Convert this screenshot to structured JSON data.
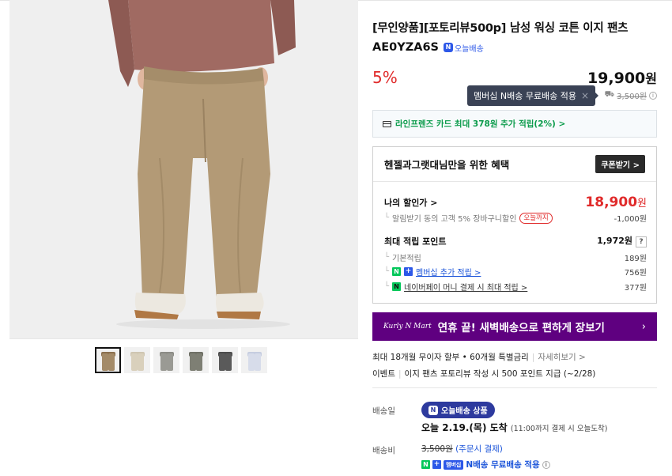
{
  "product": {
    "title": "[무인양품][포토리뷰500p] 남성 워싱 코튼 이지 팬츠",
    "code": "AE0YZA6S",
    "today_delivery_badge": "오늘배송",
    "discount_rate": "5%",
    "price": "19,900",
    "price_unit": "원"
  },
  "tooltip": {
    "text": "멤버십 N배송 무료배송 적용",
    "close": "×"
  },
  "shipping_note": {
    "icon": "truck-icon",
    "strike_price": "3,500원",
    "info": "i"
  },
  "card_offer": {
    "text": "라인프렌즈 카드 최대 378원 추가 적립(2%) >"
  },
  "benefit": {
    "title": "헨젤과그랫대님만을 위한 혜택",
    "coupon_button": "쿠폰받기 >",
    "my_price_label": "나의 할인가 >",
    "my_price": "18,900",
    "my_price_unit": "원",
    "alarm_discount_text": "알림받기 동의 고객 5% 장바구니할인",
    "alarm_pill": "오늘까지",
    "alarm_discount_value": "-1,000원",
    "max_points_label": "최대 적립 포인트",
    "max_points": "1,972원",
    "question": "?",
    "basic_points_label": "기본적립",
    "basic_points": "189원",
    "membership_points_label": "멤버십 추가 적립 >",
    "membership_points": "756원",
    "npay_points_label": "네이버페이 머니 결제 시 최대 적립 >",
    "npay_points": "377원"
  },
  "kurly_banner": {
    "logo": "Kurly N Mart",
    "text": "연휴 끝! 새벽배송으로 편하게 장보기",
    "arrow": "›"
  },
  "installment": {
    "text": "최대 18개월 무이자 할부 • 60개월 특별금리",
    "link": "자세히보기 >"
  },
  "event": {
    "label": "이벤트",
    "text": "이지 팬츠 포토리뷰 작성 시 500 포인트 지급 (~2/28)"
  },
  "delivery": {
    "date_label": "배송일",
    "pill": "오늘배송 상품",
    "arrive_main": "오늘 2.19.(목) 도착",
    "arrive_note": "(11:00까지 결제 시 오늘도착)",
    "fee_label": "배송비",
    "fee_strike": "3,500원",
    "fee_note": "(주문시 결제)",
    "free_tag": "멤버십",
    "free_text": "N배송 무료배송 적용"
  },
  "colors": {
    "accent_red": "#e02a2a",
    "naver_green": "#03c75a",
    "kurly_purple": "#5f0080",
    "blue": "#1a53d9"
  }
}
